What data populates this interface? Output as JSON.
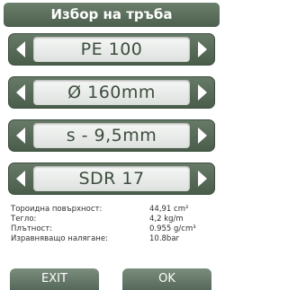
{
  "header": {
    "title": "Избор на тръба"
  },
  "selectors": [
    {
      "value": "PE 100"
    },
    {
      "value": "Ø 160mm"
    },
    {
      "value": "s - 9,5mm"
    },
    {
      "value": "SDR 17"
    }
  ],
  "info": {
    "rows": [
      {
        "label": "Тороидна повърхност:",
        "value": "44,91 cm²"
      },
      {
        "label": "Тегло:",
        "value": "4,2 kg/m"
      },
      {
        "label": "Плътност:",
        "value": "0.955 g/cm³"
      },
      {
        "label": "Изравняващо налягане:",
        "value": "10.8bar"
      }
    ]
  },
  "buttons": {
    "exit": "EXIT",
    "ok": "OK"
  },
  "colors": {
    "frame_green": "#55685a",
    "panel_text": "#3d4d3e"
  }
}
